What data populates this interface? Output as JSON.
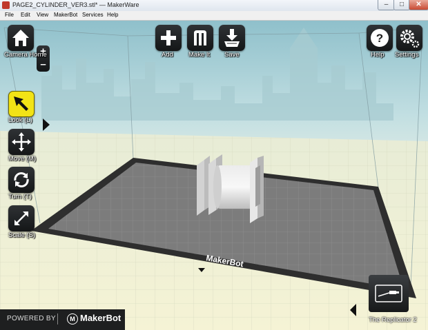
{
  "window": {
    "title": "PAGE2_CYLINDER_VER3.stl* — MakerWare",
    "minimize": "–",
    "maximize": "□",
    "close": "✕"
  },
  "menu": [
    "File",
    "Edit",
    "View",
    "MakerBot",
    "Services",
    "Help"
  ],
  "toolbar_top": {
    "camera_home": "Camera Home",
    "zoom_in": "+",
    "zoom_out": "–",
    "add": "Add",
    "make_it": "Make It",
    "save": "Save",
    "help": "Help",
    "settings": "Settings"
  },
  "toolbar_left": {
    "look": "Look (L)",
    "move": "Move (M)",
    "turn": "Turn (T)",
    "scale": "Scale (S)"
  },
  "active_tool": "look",
  "plate_brand": "MakerBot",
  "footer": {
    "powered_by": "POWERED BY",
    "logo_glyph": "M",
    "brand": "MakerBot"
  },
  "printer": {
    "name": "The Replicator 2"
  },
  "icons": [
    "home-icon",
    "plus-icon",
    "makerbot-m-icon",
    "save-icon",
    "help-icon",
    "gear-icon",
    "cursor-arrow-icon",
    "move-arrows-icon",
    "rotate-icon",
    "scale-arrow-icon",
    "usb-printer-icon"
  ],
  "colors": {
    "active_tool": "#f2e316",
    "build_plate": "#7c7c7c",
    "plate_border": "#2e2e2e",
    "floor": "#f1f1d8",
    "sky": "#9bc7d1"
  }
}
